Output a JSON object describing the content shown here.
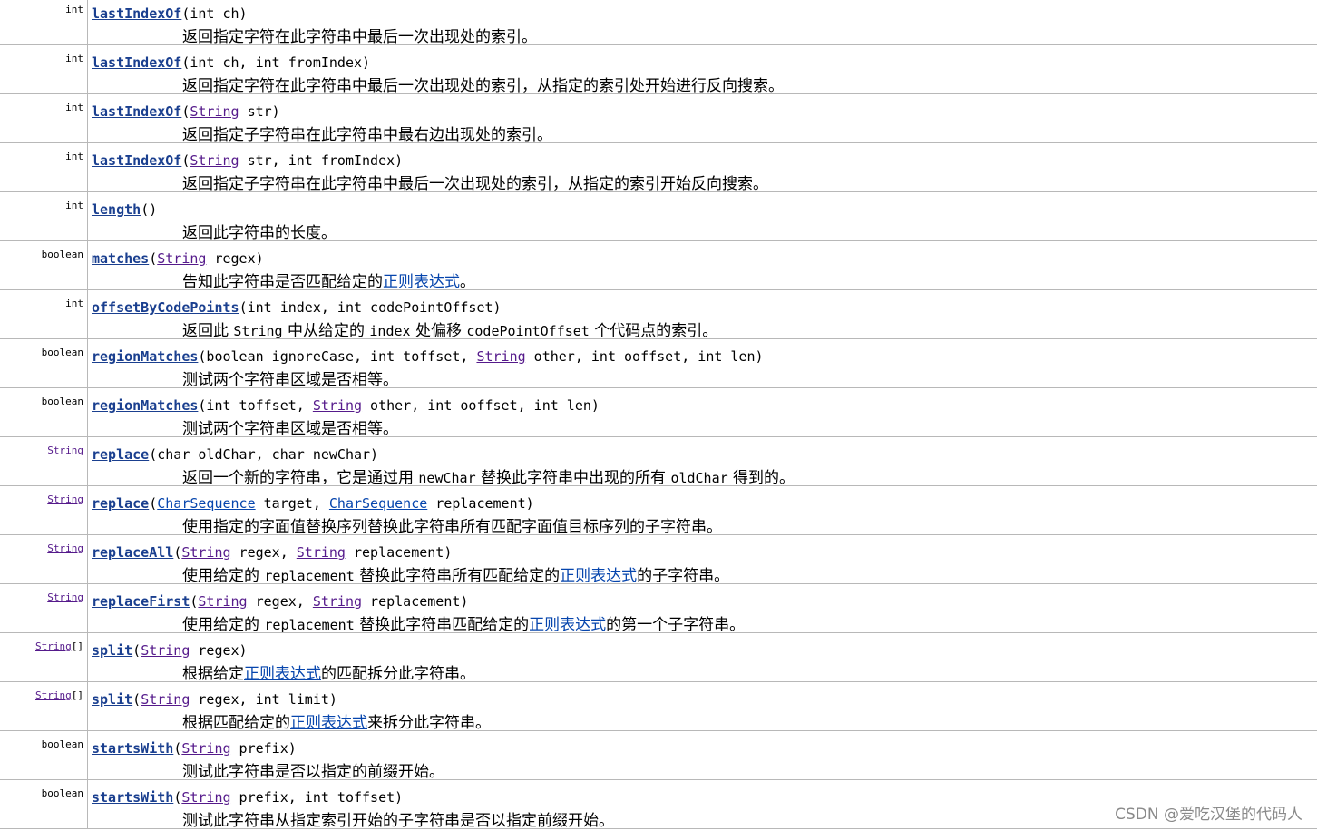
{
  "rows": [
    {
      "type": [
        {
          "t": "int"
        }
      ],
      "sig": [
        {
          "t": "lastIndexOf",
          "k": "m"
        },
        {
          "t": "(int ch)"
        }
      ],
      "desc": [
        {
          "t": "返回指定字符在此字符串中最后一次出现处的索引。"
        }
      ]
    },
    {
      "type": [
        {
          "t": "int"
        }
      ],
      "sig": [
        {
          "t": "lastIndexOf",
          "k": "m"
        },
        {
          "t": "(int ch, int fromIndex)"
        }
      ],
      "desc": [
        {
          "t": "返回指定字符在此字符串中最后一次出现处的索引，从指定的索引处开始进行反向搜索。"
        }
      ]
    },
    {
      "type": [
        {
          "t": "int"
        }
      ],
      "sig": [
        {
          "t": "lastIndexOf",
          "k": "m"
        },
        {
          "t": "("
        },
        {
          "t": "String",
          "k": "l"
        },
        {
          "t": " str)"
        }
      ],
      "desc": [
        {
          "t": "返回指定子字符串在此字符串中最右边出现处的索引。"
        }
      ]
    },
    {
      "type": [
        {
          "t": "int"
        }
      ],
      "sig": [
        {
          "t": "lastIndexOf",
          "k": "m"
        },
        {
          "t": "("
        },
        {
          "t": "String",
          "k": "l"
        },
        {
          "t": " str, int fromIndex)"
        }
      ],
      "desc": [
        {
          "t": "返回指定子字符串在此字符串中最后一次出现处的索引，从指定的索引开始反向搜索。"
        }
      ]
    },
    {
      "type": [
        {
          "t": "int"
        }
      ],
      "sig": [
        {
          "t": "length",
          "k": "m"
        },
        {
          "t": "()"
        }
      ],
      "desc": [
        {
          "t": "返回此字符串的长度。"
        }
      ]
    },
    {
      "type": [
        {
          "t": "boolean"
        }
      ],
      "sig": [
        {
          "t": "matches",
          "k": "m"
        },
        {
          "t": "("
        },
        {
          "t": "String",
          "k": "l"
        },
        {
          "t": " regex)"
        }
      ],
      "desc": [
        {
          "t": "告知此字符串是否匹配给定的"
        },
        {
          "t": "正则表达式",
          "k": "r"
        },
        {
          "t": "。"
        }
      ]
    },
    {
      "type": [
        {
          "t": "int"
        }
      ],
      "sig": [
        {
          "t": "offsetByCodePoints",
          "k": "m"
        },
        {
          "t": "(int index, int codePointOffset)"
        }
      ],
      "desc": [
        {
          "t": "返回此 "
        },
        {
          "t": "String",
          "k": "c"
        },
        {
          "t": " 中从给定的 "
        },
        {
          "t": "index",
          "k": "c"
        },
        {
          "t": " 处偏移 "
        },
        {
          "t": "codePointOffset",
          "k": "c"
        },
        {
          "t": " 个代码点的索引。"
        }
      ]
    },
    {
      "type": [
        {
          "t": "boolean"
        }
      ],
      "sig": [
        {
          "t": "regionMatches",
          "k": "m"
        },
        {
          "t": "(boolean ignoreCase, int toffset, "
        },
        {
          "t": "String",
          "k": "l"
        },
        {
          "t": " other, int ooffset, int len)"
        }
      ],
      "desc": [
        {
          "t": "测试两个字符串区域是否相等。"
        }
      ]
    },
    {
      "type": [
        {
          "t": "boolean"
        }
      ],
      "sig": [
        {
          "t": "regionMatches",
          "k": "m"
        },
        {
          "t": "(int toffset, "
        },
        {
          "t": "String",
          "k": "l"
        },
        {
          "t": " other, int ooffset, int len)"
        }
      ],
      "desc": [
        {
          "t": "测试两个字符串区域是否相等。"
        }
      ]
    },
    {
      "type": [
        {
          "t": "String",
          "k": "l"
        }
      ],
      "sig": [
        {
          "t": "replace",
          "k": "m"
        },
        {
          "t": "(char oldChar, char newChar)"
        }
      ],
      "desc": [
        {
          "t": "返回一个新的字符串，它是通过用 "
        },
        {
          "t": "newChar",
          "k": "c"
        },
        {
          "t": " 替换此字符串中出现的所有 "
        },
        {
          "t": "oldChar",
          "k": "c"
        },
        {
          "t": " 得到的。"
        }
      ]
    },
    {
      "type": [
        {
          "t": "String",
          "k": "l"
        }
      ],
      "sig": [
        {
          "t": "replace",
          "k": "m"
        },
        {
          "t": "("
        },
        {
          "t": "CharSequence",
          "k": "lb"
        },
        {
          "t": " target, "
        },
        {
          "t": "CharSequence",
          "k": "lb"
        },
        {
          "t": " replacement)"
        }
      ],
      "desc": [
        {
          "t": "使用指定的字面值替换序列替换此字符串所有匹配字面值目标序列的子字符串。"
        }
      ]
    },
    {
      "type": [
        {
          "t": "String",
          "k": "l"
        }
      ],
      "sig": [
        {
          "t": "replaceAll",
          "k": "m"
        },
        {
          "t": "("
        },
        {
          "t": "String",
          "k": "l"
        },
        {
          "t": " regex, "
        },
        {
          "t": "String",
          "k": "l"
        },
        {
          "t": " replacement)"
        }
      ],
      "desc": [
        {
          "t": "使用给定的 "
        },
        {
          "t": "replacement",
          "k": "c"
        },
        {
          "t": " 替换此字符串所有匹配给定的"
        },
        {
          "t": "正则表达式",
          "k": "r"
        },
        {
          "t": "的子字符串。"
        }
      ]
    },
    {
      "type": [
        {
          "t": "String",
          "k": "l"
        }
      ],
      "sig": [
        {
          "t": "replaceFirst",
          "k": "m"
        },
        {
          "t": "("
        },
        {
          "t": "String",
          "k": "l"
        },
        {
          "t": " regex, "
        },
        {
          "t": "String",
          "k": "l"
        },
        {
          "t": " replacement)"
        }
      ],
      "desc": [
        {
          "t": "使用给定的 "
        },
        {
          "t": "replacement",
          "k": "c"
        },
        {
          "t": " 替换此字符串匹配给定的"
        },
        {
          "t": "正则表达式",
          "k": "r"
        },
        {
          "t": "的第一个子字符串。"
        }
      ]
    },
    {
      "type": [
        {
          "t": "String",
          "k": "l"
        },
        {
          "t": "[]"
        }
      ],
      "sig": [
        {
          "t": "split",
          "k": "m"
        },
        {
          "t": "("
        },
        {
          "t": "String",
          "k": "l"
        },
        {
          "t": " regex)"
        }
      ],
      "desc": [
        {
          "t": "根据给定"
        },
        {
          "t": "正则表达式",
          "k": "r"
        },
        {
          "t": "的匹配拆分此字符串。"
        }
      ]
    },
    {
      "type": [
        {
          "t": "String",
          "k": "l"
        },
        {
          "t": "[]"
        }
      ],
      "sig": [
        {
          "t": "split",
          "k": "m"
        },
        {
          "t": "("
        },
        {
          "t": "String",
          "k": "l"
        },
        {
          "t": " regex, int limit)"
        }
      ],
      "desc": [
        {
          "t": "根据匹配给定的"
        },
        {
          "t": "正则表达式",
          "k": "r"
        },
        {
          "t": "来拆分此字符串。"
        }
      ]
    },
    {
      "type": [
        {
          "t": "boolean"
        }
      ],
      "sig": [
        {
          "t": "startsWith",
          "k": "m"
        },
        {
          "t": "("
        },
        {
          "t": "String",
          "k": "l"
        },
        {
          "t": " prefix)"
        }
      ],
      "desc": [
        {
          "t": "测试此字符串是否以指定的前缀开始。"
        }
      ]
    },
    {
      "type": [
        {
          "t": "boolean"
        }
      ],
      "sig": [
        {
          "t": "startsWith",
          "k": "m"
        },
        {
          "t": "("
        },
        {
          "t": "String",
          "k": "l"
        },
        {
          "t": " prefix, int toffset)"
        }
      ],
      "desc": [
        {
          "t": "测试此字符串从指定索引开始的子字符串是否以指定前缀开始。"
        }
      ]
    }
  ],
  "watermark": "CSDN @爱吃汉堡的代码人"
}
